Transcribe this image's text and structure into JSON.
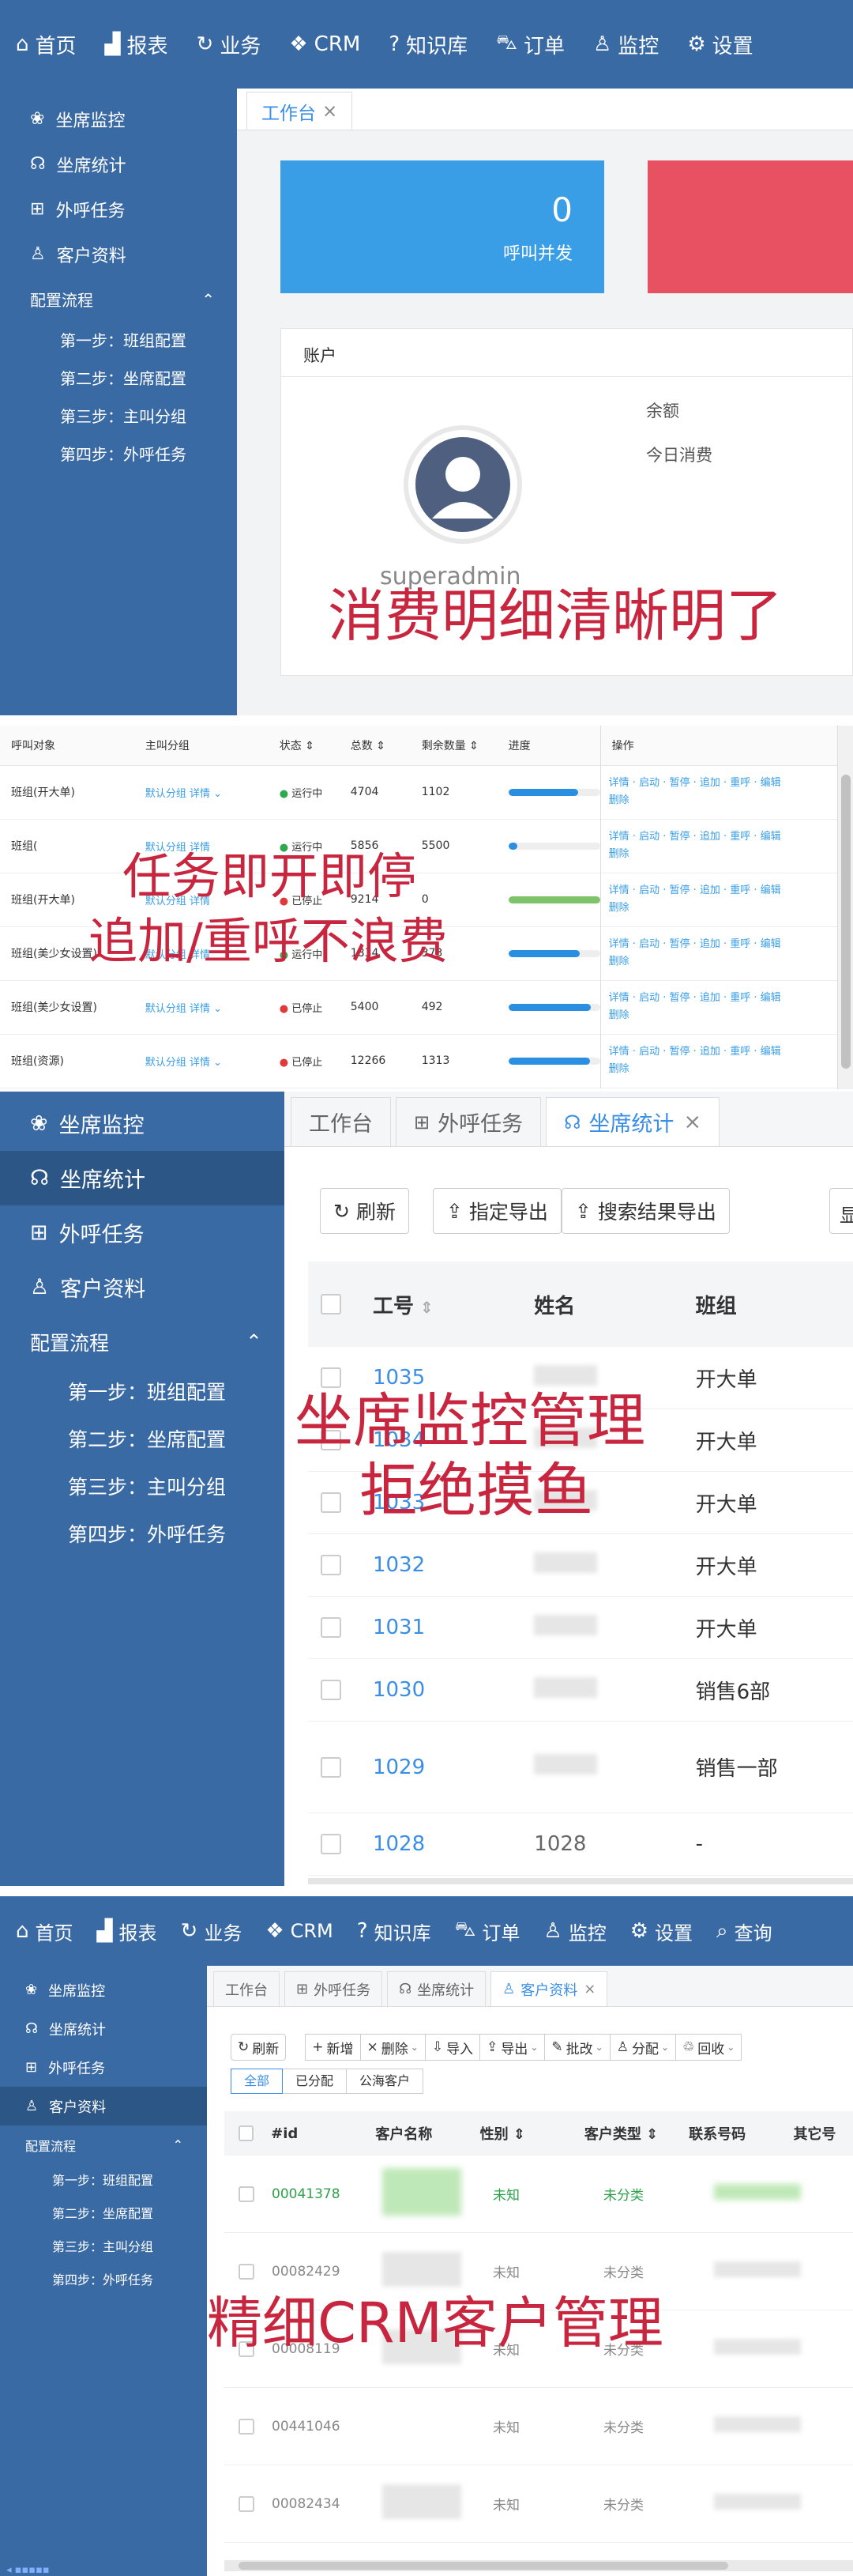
{
  "topnav": {
    "items": [
      {
        "label": "首页",
        "icon": "home-icon",
        "glyph": "⌂"
      },
      {
        "label": "报表",
        "icon": "chart-icon",
        "glyph": "▟"
      },
      {
        "label": "业务",
        "icon": "refresh-icon",
        "glyph": "↻"
      },
      {
        "label": "CRM",
        "icon": "crm-icon",
        "glyph": "❖"
      },
      {
        "label": "知识库",
        "icon": "help-icon",
        "glyph": "?"
      },
      {
        "label": "订单",
        "icon": "cart-icon",
        "glyph": "⛍"
      },
      {
        "label": "监控",
        "icon": "monitor-icon",
        "glyph": "♙"
      },
      {
        "label": "设置",
        "icon": "gear-icon",
        "glyph": "⚙"
      }
    ],
    "query_label": "查询"
  },
  "sidebar": {
    "items": [
      {
        "label": "坐席监控",
        "icon": "agent-monitor-icon",
        "glyph": "❀"
      },
      {
        "label": "坐席统计",
        "icon": "headset-icon",
        "glyph": "☊"
      },
      {
        "label": "外呼任务",
        "icon": "grid-icon",
        "glyph": "⊞"
      },
      {
        "label": "客户资料",
        "icon": "user-icon",
        "glyph": "♙"
      }
    ],
    "group": "配置流程",
    "subitems": [
      "第一步：班组配置",
      "第二步：坐席配置",
      "第三步：主叫分组",
      "第四步：外呼任务"
    ]
  },
  "panel1": {
    "tab": "工作台",
    "stat_value": "0",
    "stat_label": "呼叫并发",
    "account_title": "账户",
    "balance_label": "余额",
    "today_label": "今日消费",
    "username": "superadmin",
    "overlay": "消费明细清晰明了"
  },
  "panel2": {
    "headers": [
      "呼叫对象",
      "主叫分组",
      "状态 ⇕",
      "总数 ⇕",
      "剩余数量 ⇕",
      "进度",
      "操作"
    ],
    "rows": [
      {
        "name": "班组(开大单)",
        "group": "默认分组 详情 ⌄",
        "status": "运行中",
        "running": true,
        "total": "4704",
        "remain": "1102",
        "progress": 0.76
      },
      {
        "name": "班组(",
        "group": "默认分组 详情",
        "status": "运行中",
        "running": true,
        "total": "5856",
        "remain": "5500",
        "progress": 0.1
      },
      {
        "name": "班组(开大单)",
        "group": "默认分组 详情",
        "status": "已停止",
        "running": false,
        "total": "9214",
        "remain": "0",
        "progress": 1.0
      },
      {
        "name": "班组(美少女设置)",
        "group": "默认分组 详情",
        "status": "运行中",
        "running": true,
        "total": "1834",
        "remain": "373",
        "progress": 0.78
      },
      {
        "name": "班组(美少女设置)",
        "group": "默认分组 详情 ⌄",
        "status": "已停止",
        "running": false,
        "total": "5400",
        "remain": "492",
        "progress": 0.9
      },
      {
        "name": "班组(资源)",
        "group": "默认分组 详情 ⌄",
        "status": "已停止",
        "running": false,
        "total": "12266",
        "remain": "1313",
        "progress": 0.89
      }
    ],
    "action_line1": "详情 · 启动 · 暂停 · 追加 · 重呼 · 编辑",
    "action_line2": "删除",
    "overlay_line1": "任务即开即停",
    "overlay_line2": "追加/重呼不浪费"
  },
  "panel3": {
    "tabs": [
      "工作台",
      "外呼任务",
      "坐席统计"
    ],
    "buttons": [
      "刷新",
      "指定导出",
      "搜索结果导出"
    ],
    "cols": [
      "工号",
      "姓名",
      "班组"
    ],
    "rows": [
      {
        "id": "1035",
        "name": "",
        "team": "开大单"
      },
      {
        "id": "1034",
        "name": "",
        "team": "开大单"
      },
      {
        "id": "1033",
        "name": "",
        "team": "开大单"
      },
      {
        "id": "1032",
        "name": "",
        "team": "开大单"
      },
      {
        "id": "1031",
        "name": "",
        "team": "开大单"
      },
      {
        "id": "1030",
        "name": "",
        "team": "销售6部"
      },
      {
        "id": "1029",
        "name": "",
        "team": "销售一部"
      },
      {
        "id": "1028",
        "name": "1028",
        "team": "-"
      }
    ],
    "overlay_line1": "坐席监控管理",
    "overlay_line2": "拒绝摸鱼"
  },
  "panel4": {
    "tabs": [
      "工作台",
      "外呼任务",
      "坐席统计",
      "客户资料"
    ],
    "toolbar": [
      "刷新",
      "新增",
      "删除",
      "导入",
      "导出",
      "批改",
      "分配",
      "回收"
    ],
    "filters": [
      "全部",
      "已分配",
      "公海客户"
    ],
    "cols": [
      "#id",
      "客户名称",
      "性别 ⇕",
      "客户类型 ⇕",
      "联系号码",
      "其它号"
    ],
    "rows": [
      {
        "id": "00041378",
        "gender": "未知",
        "type": "未分类",
        "hl": true
      },
      {
        "id": "00082429",
        "gender": "未知",
        "type": "未分类",
        "hl": false
      },
      {
        "id": "00008119",
        "gender": "未知",
        "type": "未分类",
        "hl": false
      },
      {
        "id": "00441046",
        "gender": "未知",
        "type": "未分类",
        "hl": false
      },
      {
        "id": "00082434",
        "gender": "未知",
        "type": "未分类",
        "hl": false
      }
    ],
    "overlay": "精细CRM客户管理"
  },
  "colors": {
    "brand": "#3a6aa3",
    "sidebar_active": "#2c5686",
    "accent_blue": "#3a9ee6",
    "red_card": "#e85161",
    "overlay_red": "#c8253f",
    "running_green": "#2fa84f",
    "stopped_red": "#e03a3a"
  }
}
